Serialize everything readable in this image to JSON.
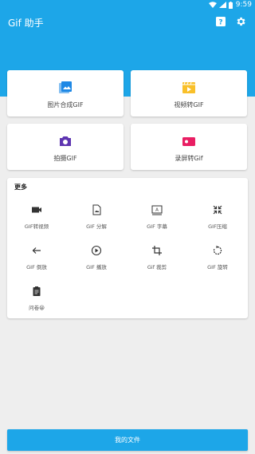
{
  "status_bar": {
    "time": "9:59"
  },
  "app_bar": {
    "title": "Gif 助手"
  },
  "main_cards": [
    {
      "label": "图片合成GIF",
      "icon": "image-icon",
      "color": "#1e88e5"
    },
    {
      "label": "视频转GIF",
      "icon": "video-clip-icon",
      "color": "#f9c02a"
    },
    {
      "label": "拍摄GIF",
      "icon": "camera-icon",
      "color": "#5e35b1"
    },
    {
      "label": "录屏转Gif",
      "icon": "screen-record-icon",
      "color": "#e91e63"
    }
  ],
  "more": {
    "title": "更多",
    "items": [
      {
        "label": "GIF转视频",
        "icon": "video-camera-icon"
      },
      {
        "label": "GIF 分解",
        "icon": "split-image-icon"
      },
      {
        "label": "GIF 字幕",
        "icon": "subtitle-icon"
      },
      {
        "label": "GIF压缩",
        "icon": "compress-icon"
      },
      {
        "label": "GIF 倒放",
        "icon": "arrow-left-icon"
      },
      {
        "label": "GIF 播放",
        "icon": "play-icon"
      },
      {
        "label": "Gif 裁剪",
        "icon": "crop-icon"
      },
      {
        "label": "GIF 旋转",
        "icon": "rotate-icon"
      },
      {
        "label": "问卷😀",
        "icon": "clipboard-icon"
      }
    ]
  },
  "bottom_button": {
    "label": "我的文件"
  },
  "colors": {
    "primary": "#1da6e8",
    "background": "#eeeeee"
  }
}
